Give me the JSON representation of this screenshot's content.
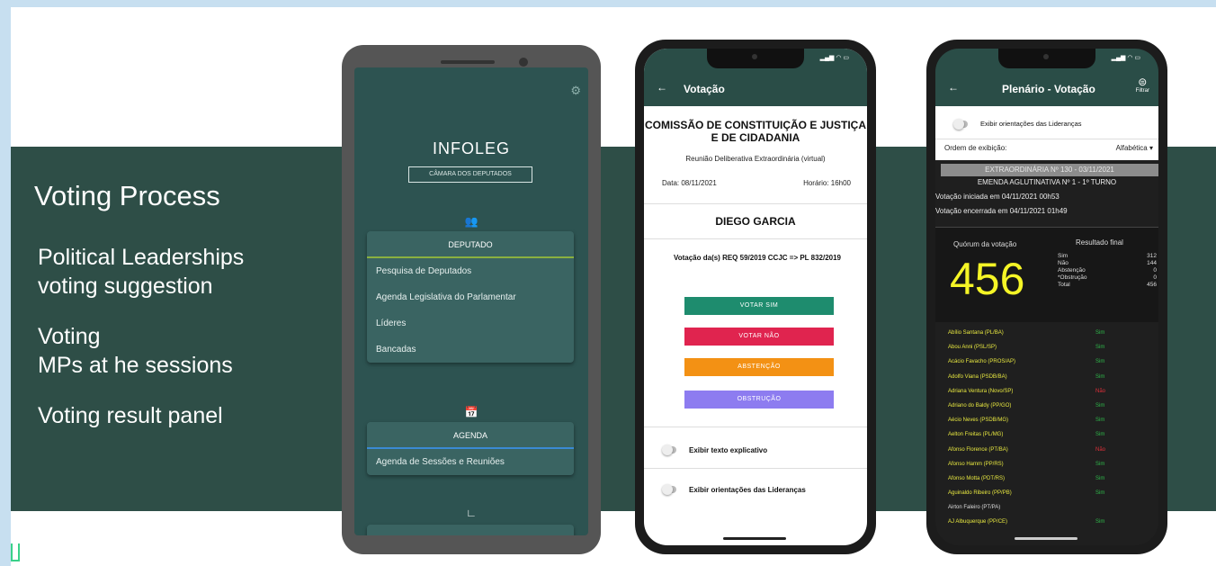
{
  "slide": {
    "heading": "Voting Process",
    "points": [
      [
        "Political Leaderships",
        "voting suggestion"
      ],
      [
        "Voting",
        "MPs at he sessions"
      ],
      [
        "Voting result panel"
      ]
    ]
  },
  "phone1": {
    "app_name": "INFOLEG",
    "chamber": "CÂMARA DOS DEPUTADOS",
    "deputado": {
      "header": "DEPUTADO",
      "items": [
        "Pesquisa de Deputados",
        "Agenda Legislativa do Parlamentar",
        "Líderes",
        "Bancadas"
      ]
    },
    "agenda": {
      "header": "AGENDA",
      "items": [
        "Agenda de Sessões e Reuniões"
      ]
    }
  },
  "phone2": {
    "bar_title": "Votação",
    "committee": "COMISSÃO DE CONSTITUIÇÃO E JUSTIÇA E DE CIDADANIA",
    "meeting": "Reunião Deliberativa Extraordinária (virtual)",
    "date": "Data: 08/11/2021",
    "time": "Horário: 16h00",
    "deputy": "DIEGO GARCIA",
    "vote_desc": "Votação da(s) REQ 59/2019 CCJC => PL 832/2019",
    "buttons": [
      {
        "label": "VOTAR SIM",
        "color": "#1e8c6e"
      },
      {
        "label": "VOTAR NÃO",
        "color": "#e0244f"
      },
      {
        "label": "ABSTENÇÃO",
        "color": "#f39114"
      },
      {
        "label": "OBSTRUÇÃO",
        "color": "#8d7cf0"
      }
    ],
    "toggle1": "Exibir texto explicativo",
    "toggle2": "Exibir orientações das Lideranças"
  },
  "phone3": {
    "bar_title": "Plenário - Votação",
    "filter_label": "Filtrar",
    "toggle": "Exibir orientações das Lideranças",
    "order_label": "Ordem de exibição:",
    "order_value": "Alfabética",
    "session": "EXTRAORDINÁRIA Nº 130 - 03/11/2021",
    "amendment": "EMENDA AGLUTINATIVA Nº 1 - 1º TURNO",
    "started": "Votação iniciada em 04/11/2021 00h53",
    "ended": "Votação encerrada em 04/11/2021 01h49",
    "quorum_label": "Quórum da votação",
    "result_label": "Resultado final",
    "quorum": "456",
    "results": [
      {
        "k": "Sim",
        "v": "312"
      },
      {
        "k": "Não",
        "v": "144"
      },
      {
        "k": "Abstenção",
        "v": "0"
      },
      {
        "k": "*Obstrução",
        "v": "0"
      },
      {
        "k": "Total",
        "v": "456"
      }
    ],
    "votes": [
      {
        "name": "Abílio Santana (PL/BA)",
        "vote": "Sim",
        "color": "#e8e840",
        "vcolor": "#2fb84a"
      },
      {
        "name": "Abou Anni (PSL/SP)",
        "vote": "Sim",
        "color": "#e8e840",
        "vcolor": "#2fb84a"
      },
      {
        "name": "Acácio Favacho (PROS/AP)",
        "vote": "Sim",
        "color": "#e8e840",
        "vcolor": "#2fb84a"
      },
      {
        "name": "Adolfo Viana (PSDB/BA)",
        "vote": "Sim",
        "color": "#e8e840",
        "vcolor": "#2fb84a"
      },
      {
        "name": "Adriana Ventura (Novo/SP)",
        "vote": "Não",
        "color": "#e8e840",
        "vcolor": "#e0303a"
      },
      {
        "name": "Adriano do Baldy (PP/GO)",
        "vote": "Sim",
        "color": "#e8e840",
        "vcolor": "#2fb84a"
      },
      {
        "name": "Aécio Neves (PSDB/MG)",
        "vote": "Sim",
        "color": "#e8e840",
        "vcolor": "#2fb84a"
      },
      {
        "name": "Aelton Freitas (PL/MG)",
        "vote": "Sim",
        "color": "#e8e840",
        "vcolor": "#2fb84a"
      },
      {
        "name": "Afonso Florence (PT/BA)",
        "vote": "Não",
        "color": "#e8e840",
        "vcolor": "#e0303a"
      },
      {
        "name": "Afonso Hamm (PP/RS)",
        "vote": "Sim",
        "color": "#e8e840",
        "vcolor": "#2fb84a"
      },
      {
        "name": "Afonso Motta (PDT/RS)",
        "vote": "Sim",
        "color": "#e8e840",
        "vcolor": "#2fb84a"
      },
      {
        "name": "Aguinaldo Ribeiro (PP/PB)",
        "vote": "Sim",
        "color": "#e8e840",
        "vcolor": "#2fb84a"
      },
      {
        "name": "Airton Faleiro (PT/PA)",
        "vote": "",
        "color": "#dddddd",
        "vcolor": "#dddddd"
      },
      {
        "name": "AJ Albuquerque (PP/CE)",
        "vote": "Sim",
        "color": "#e8e840",
        "vcolor": "#2fb84a"
      }
    ]
  }
}
